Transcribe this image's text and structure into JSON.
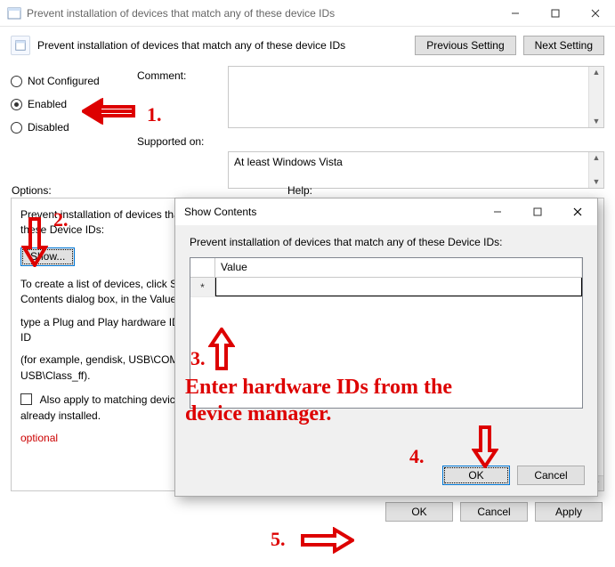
{
  "window": {
    "title": "Prevent installation of devices that match any of these device IDs"
  },
  "policy_title": "Prevent installation of devices that match any of these device IDs",
  "nav": {
    "prev": "Previous Setting",
    "next": "Next Setting"
  },
  "state": {
    "not_configured": "Not Configured",
    "enabled": "Enabled",
    "disabled": "Disabled",
    "selected": "Enabled"
  },
  "labels": {
    "comment": "Comment:",
    "supported": "Supported on:"
  },
  "supported_text": "At least Windows Vista",
  "left_panel": {
    "heading": "Options:",
    "line1": "Prevent installation of devices that match any of these Device IDs:",
    "show": "Show...",
    "line2": "To create a list of devices, click Show. In the Show Contents dialog box, in the Value column,",
    "line3": "type a Plug and Play hardware ID or compatible ID",
    "line4": "(for example, gendisk, USB\\COMPOSITE, USB\\Class_ff).",
    "chk": "Also apply to matching devices that are already installed.",
    "optional": "optional"
  },
  "right_panel": {
    "heading": "Help:"
  },
  "modal": {
    "title": "Show Contents",
    "desc": "Prevent installation of devices that match any of these Device IDs:",
    "col": "Value",
    "new_row_marker": "*",
    "ok": "OK",
    "cancel": "Cancel"
  },
  "footer": {
    "ok": "OK",
    "cancel": "Cancel",
    "apply": "Apply"
  },
  "annotations": {
    "n1": "1.",
    "n2": "2.",
    "n3": "3.",
    "n4": "4.",
    "n5": "5.",
    "instr": "Enter hardware IDs from the device manager."
  }
}
